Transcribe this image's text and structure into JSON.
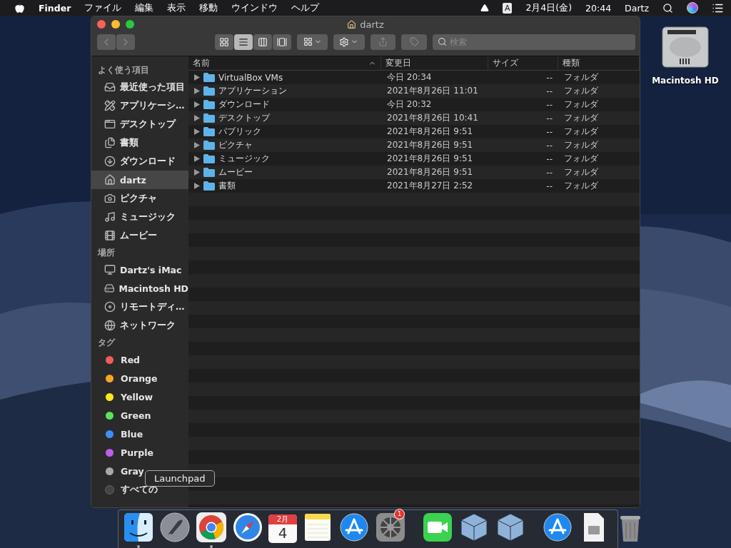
{
  "menubar": {
    "app": "Finder",
    "menus": [
      "ファイル",
      "編集",
      "表示",
      "移動",
      "ウインドウ",
      "ヘルプ"
    ],
    "input_mode": "A",
    "date": "2月4日(金)",
    "time": "20:44",
    "user": "Dartz"
  },
  "window": {
    "title": "dartz",
    "toolbar": {
      "back_disabled": true,
      "forward_disabled": true,
      "views": [
        {
          "kind": "icons",
          "selected": false
        },
        {
          "kind": "list",
          "selected": true
        },
        {
          "kind": "columns",
          "selected": false
        },
        {
          "kind": "gallery",
          "selected": false
        }
      ],
      "search": {
        "placeholder": "検索"
      }
    },
    "sidebar": [
      {
        "heading": "よく使う項目",
        "items": [
          {
            "kind": "recents",
            "label": "最近使った項目",
            "selected": false
          },
          {
            "kind": "applications",
            "label": "アプリケーシ…",
            "selected": false
          },
          {
            "kind": "desktop",
            "label": "デスクトップ",
            "selected": false
          },
          {
            "kind": "documents",
            "label": "書類",
            "selected": false
          },
          {
            "kind": "downloads",
            "label": "ダウンロード",
            "selected": false
          },
          {
            "kind": "home",
            "label": "dartz",
            "selected": true
          },
          {
            "kind": "pictures",
            "label": "ピクチャ",
            "selected": false
          },
          {
            "kind": "music",
            "label": "ミュージック",
            "selected": false
          },
          {
            "kind": "movies",
            "label": "ムービー",
            "selected": false
          }
        ]
      },
      {
        "heading": "場所",
        "items": [
          {
            "kind": "computer",
            "label": "Dartz's iMac",
            "selected": false
          },
          {
            "kind": "disk",
            "label": "Macintosh HD",
            "selected": false
          },
          {
            "kind": "disc",
            "label": "リモートディ…",
            "selected": false
          },
          {
            "kind": "network",
            "label": "ネットワーク",
            "selected": false
          }
        ]
      },
      {
        "heading": "タグ",
        "items": [
          {
            "kind": "tag",
            "label": "Red",
            "color": "#f25c5c",
            "selected": false
          },
          {
            "kind": "tag",
            "label": "Orange",
            "color": "#f5a623",
            "selected": false
          },
          {
            "kind": "tag",
            "label": "Yellow",
            "color": "#f8e71c",
            "selected": false
          },
          {
            "kind": "tag",
            "label": "Green",
            "color": "#5ae35a",
            "selected": false
          },
          {
            "kind": "tag",
            "label": "Blue",
            "color": "#3d8ff5",
            "selected": false
          },
          {
            "kind": "tag",
            "label": "Purple",
            "color": "#c25bf0",
            "selected": false
          },
          {
            "kind": "tag",
            "label": "Gray",
            "color": "#a8a8a8",
            "selected": false
          },
          {
            "kind": "alltags",
            "label": "すべての",
            "selected": false
          }
        ]
      }
    ],
    "columns": [
      {
        "label": "名前",
        "sorted": true
      },
      {
        "label": "変更日",
        "sorted": false
      },
      {
        "label": "サイズ",
        "sorted": false
      },
      {
        "label": "種類",
        "sorted": false
      }
    ],
    "rows": [
      {
        "name": "VirtualBox VMs",
        "modified": "今日 20:34",
        "size": "--",
        "kind": "フォルダ",
        "expanded": false
      },
      {
        "name": "アプリケーション",
        "modified": "2021年8月26日 11:01",
        "size": "--",
        "kind": "フォルダ",
        "expanded": false
      },
      {
        "name": "ダウンロード",
        "modified": "今日 20:32",
        "size": "--",
        "kind": "フォルダ",
        "expanded": false
      },
      {
        "name": "デスクトップ",
        "modified": "2021年8月26日 10:41",
        "size": "--",
        "kind": "フォルダ",
        "expanded": false
      },
      {
        "name": "パブリック",
        "modified": "2021年8月26日 9:51",
        "size": "--",
        "kind": "フォルダ",
        "expanded": false
      },
      {
        "name": "ピクチャ",
        "modified": "2021年8月26日 9:51",
        "size": "--",
        "kind": "フォルダ",
        "expanded": false
      },
      {
        "name": "ミュージック",
        "modified": "2021年8月26日 9:51",
        "size": "--",
        "kind": "フォルダ",
        "expanded": false
      },
      {
        "name": "ムービー",
        "modified": "2021年8月26日 9:51",
        "size": "--",
        "kind": "フォルダ",
        "expanded": false
      },
      {
        "name": "書類",
        "modified": "2021年8月27日 2:52",
        "size": "--",
        "kind": "フォルダ",
        "expanded": false
      }
    ]
  },
  "desktop_icons": [
    {
      "kind": "disk",
      "label": "Macintosh HD"
    }
  ],
  "dock": {
    "tooltip": "Launchpad",
    "items": [
      {
        "kind": "finder",
        "running": true
      },
      {
        "kind": "launchpad",
        "running": false
      },
      {
        "kind": "chrome",
        "running": true
      },
      {
        "kind": "safari",
        "running": false
      },
      {
        "kind": "calendar",
        "running": false,
        "month": "2月",
        "day": "4"
      },
      {
        "kind": "notes",
        "running": false
      },
      {
        "kind": "appstore",
        "running": false
      },
      {
        "kind": "preferences",
        "running": false,
        "badge": "1"
      },
      {
        "kind": "separator"
      },
      {
        "kind": "facetime",
        "running": false
      },
      {
        "kind": "virtualbox",
        "running": false
      },
      {
        "kind": "virtualbox",
        "running": false
      },
      {
        "kind": "separator"
      },
      {
        "kind": "downloads",
        "running": false
      },
      {
        "kind": "document",
        "running": false
      },
      {
        "kind": "trash",
        "running": false
      }
    ]
  }
}
